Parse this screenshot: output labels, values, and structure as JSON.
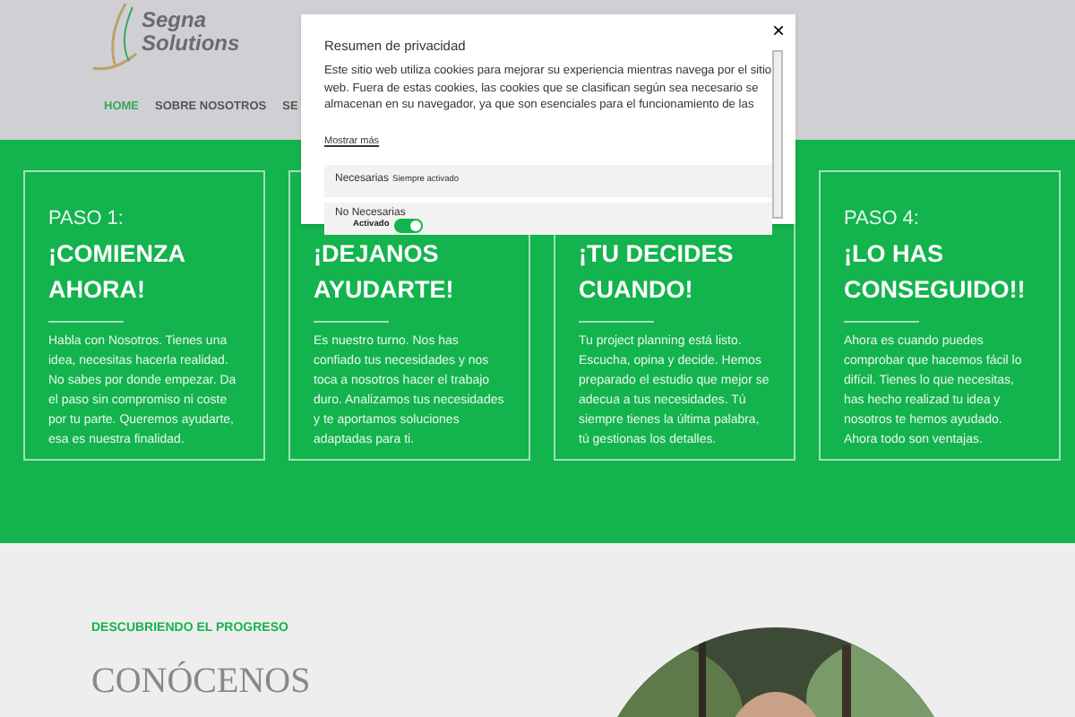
{
  "logo": {
    "lines": [
      "Segna",
      "Solutions"
    ]
  },
  "nav": [
    {
      "label": "HOME",
      "selected": true
    },
    {
      "label": "SOBRE NOSOTROS",
      "selected": false
    },
    {
      "label": "SE",
      "selected": false
    }
  ],
  "steps": [
    {
      "step": "PASO 1:",
      "title": [
        "¡COMIENZA",
        "AHORA!"
      ],
      "body": "Habla con Nosotros. Tienes una idea, necesitas hacerla realidad. No sabes por donde empezar.  Da el paso sin compromiso ni coste por tu parte. Queremos ayudarte, esa es nuestra finalidad."
    },
    {
      "title": [
        "¡DEJANOS",
        "AYUDARTE!"
      ],
      "body": "Es nuestro turno. Nos has confiado tus necesidades y nos toca a nosotros hacer el trabajo duro. Analizamos tus necesidades y te aportamos soluciones adaptadas para ti."
    },
    {
      "title": [
        "¡TU DECIDES",
        "CUANDO!"
      ],
      "body": "Tu project planning está listo. Escucha, opina y decide. Hemos preparado el estudio que mejor se adecua a tus necesidades. Tú siempre tienes la última palabra, tú gestionas los detalles."
    },
    {
      "step": "PASO 4:",
      "title": [
        "¡LO HAS",
        "CONSEGUIDO!!"
      ],
      "body": "Ahora es cuando puedes comprobar que hacemos fácil lo difícil. Tienes lo que necesitas, has hecho realizad tu idea y nosotros te hemos ayudado. Ahora todo son ventajas."
    }
  ],
  "about": {
    "eyebrow": "DESCUBRIENDO EL PROGRESO",
    "heading": "CONÓCENOS"
  },
  "privacy_modal": {
    "title": "Resumen de privacidad",
    "close": "×",
    "text": "Este sitio web utiliza cookies para mejorar su experiencia mientras navega por el sitio web. Fuera de estas cookies, las cookies que se clasifican según sea necesario se almacenan en su navegador, ya que son esenciales para el funcionamiento de las",
    "link": "Mostrar más",
    "categories": [
      {
        "kind": "fixed",
        "name": "Necesarias",
        "status": "Siempre activado"
      },
      {
        "kind": "toggle",
        "name": "No Necesarias",
        "status": "Activado",
        "on": true
      }
    ]
  }
}
